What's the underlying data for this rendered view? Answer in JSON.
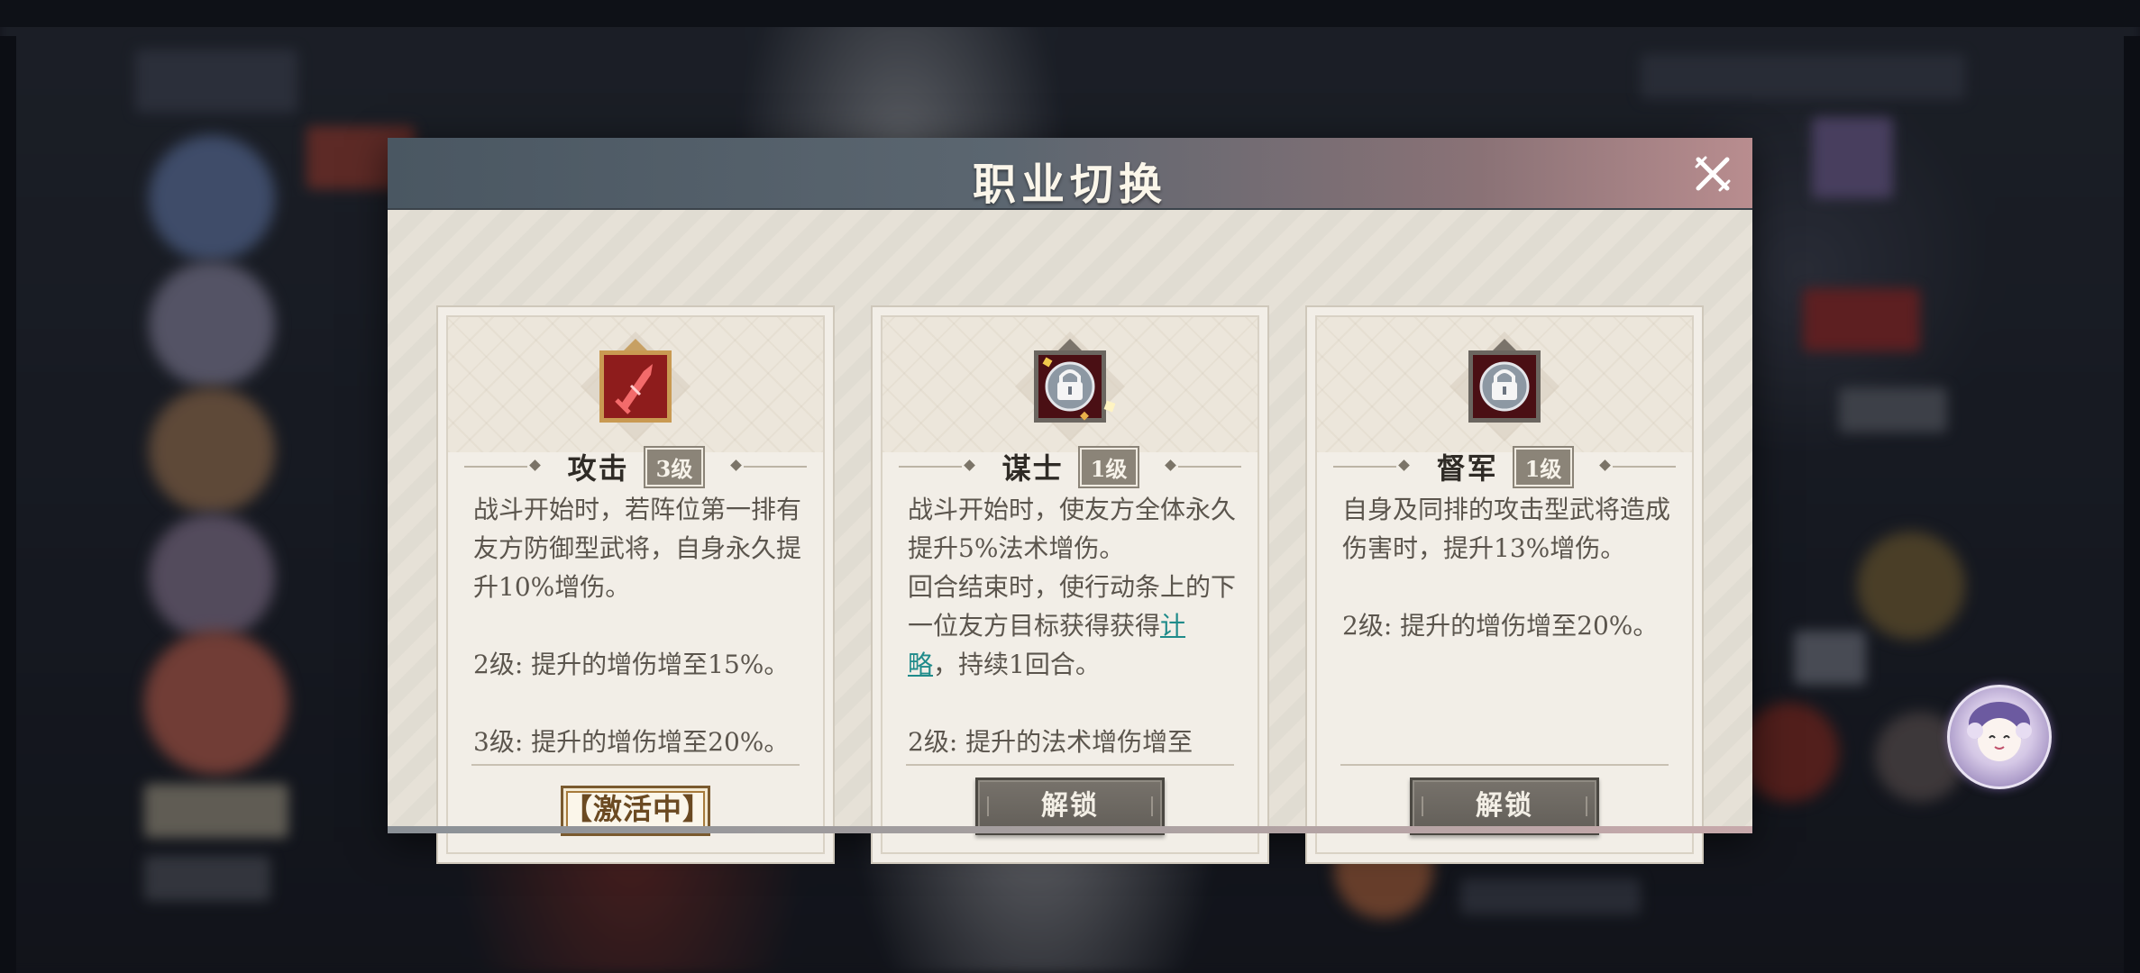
{
  "dialog": {
    "title": "职业切换"
  },
  "cards": [
    {
      "name": "攻击",
      "level": "3级",
      "icon": "red-sword-icon",
      "locked": false,
      "desc": [
        "战斗开始时，若阵位第一排有友方防御型武将，自身永久提升10%增伤。",
        "",
        "2级: 提升的增伤增至15%。",
        "",
        "3级: 提升的增伤增至20%。"
      ],
      "status": "【激活中】"
    },
    {
      "name": "谋士",
      "level": "1级",
      "icon": "lock-icon",
      "locked": true,
      "desc_a": "战斗开始时，使友方全体永久提升5%法术增伤。",
      "desc_b_pre": "回合结束时，使行动条上的下一位友方目标获得获得",
      "desc_b_link": "计略",
      "desc_b_post": "，持续1回合。",
      "desc_c": "2级: 提升的法术增伤增至",
      "button": "解锁"
    },
    {
      "name": "督军",
      "level": "1级",
      "icon": "lock-icon",
      "locked": true,
      "desc": [
        "自身及同排的攻击型武将造成伤害时，提升13%增伤。",
        "",
        "2级: 提升的增伤增至20%。"
      ],
      "button": "解锁"
    }
  ],
  "colors": {
    "header_start": "#4a5762",
    "header_end": "#b98d8f",
    "link": "#1f8b8a",
    "emblem_red": "#8e1c1c",
    "button_gray": "#6d6963"
  },
  "mascot": "chibi-mascot-avatar"
}
